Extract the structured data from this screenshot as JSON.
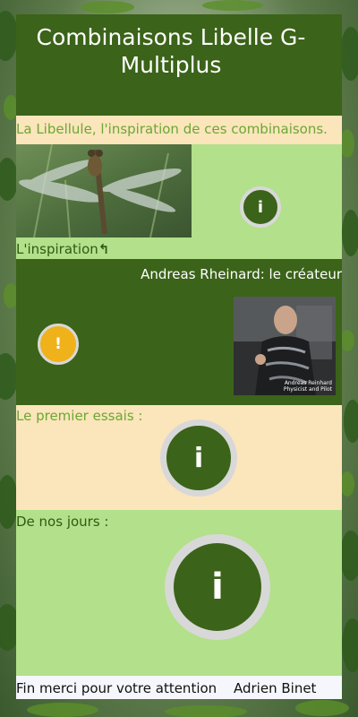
{
  "header": {
    "title": "Combinaisons Libelle G-Multiplus"
  },
  "sections": [
    {
      "bar_text": "La Libellule, l'inspiration de ces combinaisons.",
      "caption": "L'inspiration",
      "caption_arrow": "↰",
      "info_glyph": "i"
    },
    {
      "title": "Andreas Rheinard: le créateur",
      "info_glyph": "!",
      "photo_caption": "Andreas Reinhard\nPhysicist and Pilot"
    },
    {
      "label": "Le premier essais :",
      "info_glyph": "i"
    },
    {
      "label": "De nos jours :",
      "info_glyph": "i"
    }
  ],
  "footer": {
    "left": "Fin merci pour votre attention",
    "right": "Adrien Binet"
  },
  "colors": {
    "header_green": "#3b6319",
    "light_green": "#b3e08a",
    "cream": "#fbe5bb",
    "accent_green_text": "#6aa833",
    "warning_orange": "#f0b21a",
    "ring_gray": "#d8d8d8"
  },
  "icons": [
    "info-icon",
    "warning-icon",
    "curved-arrow-icon"
  ]
}
